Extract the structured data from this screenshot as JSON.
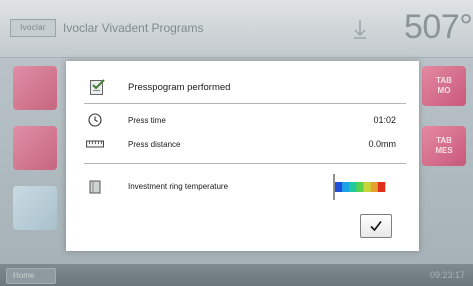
{
  "header": {
    "logo_text": "Ivoclar",
    "title": "Ivoclar Vivadent Programs",
    "temperature": "507°"
  },
  "background": {
    "right_tiles": [
      {
        "label_top": "TAB",
        "label_bottom": "MO"
      },
      {
        "label_top": "TAB",
        "label_bottom": "MES"
      }
    ]
  },
  "footer": {
    "home_label": "Home",
    "clock": "09:23:17"
  },
  "dialog": {
    "title": "Presspogram performed",
    "press_time_label": "Press time",
    "press_time_value": "01:02",
    "press_distance_label": "Press distance",
    "press_distance_value": "0.0mm",
    "ring_temp_label": "Investment ring temperature",
    "gauge_colors": [
      "#1f4ed8",
      "#1aa3e8",
      "#20c9a0",
      "#58d24a",
      "#c8d43a",
      "#e8a030",
      "#e0301c"
    ],
    "gauge_marker_fraction": 0.0
  },
  "icons": {
    "program_icon": "clipboard-check-icon",
    "clock_icon": "clock-icon",
    "ruler_icon": "ruler-icon",
    "ring_icon": "cylinder-icon",
    "ok_icon": "checkmark-icon"
  }
}
